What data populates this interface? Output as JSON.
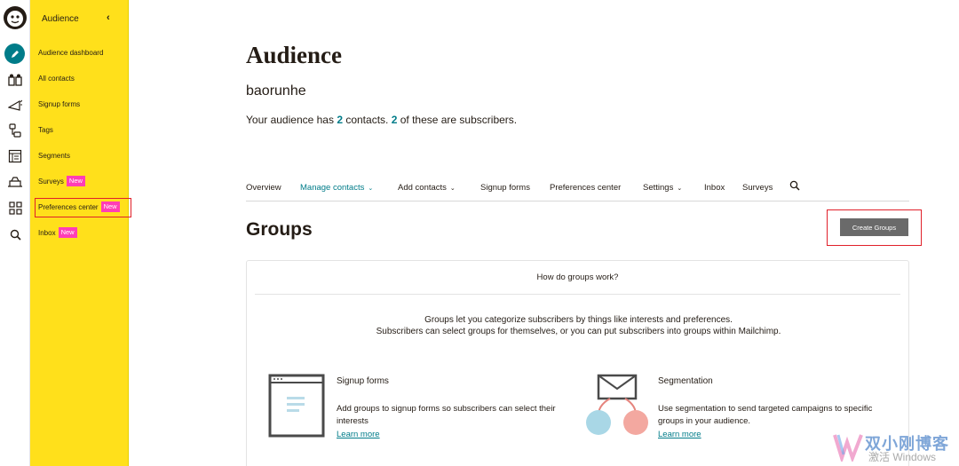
{
  "rail": {
    "icons": [
      "mailchimp-logo",
      "create-icon",
      "audience-icon",
      "campaigns-icon",
      "automations-icon",
      "website-icon",
      "content-icon",
      "integrations-icon",
      "search-icon"
    ]
  },
  "sidebar": {
    "title": "Audience",
    "collapse_icon": "‹",
    "items": [
      {
        "label": "Audience dashboard"
      },
      {
        "label": "All contacts"
      },
      {
        "label": "Signup forms"
      },
      {
        "label": "Tags"
      },
      {
        "label": "Segments"
      },
      {
        "label": "Surveys",
        "badge": "New"
      },
      {
        "label": "Preferences center",
        "badge": "New"
      },
      {
        "label": "Inbox",
        "badge": "New"
      }
    ]
  },
  "page": {
    "title": "Audience",
    "audience_name": "baorunhe",
    "summary": {
      "pre": "Your audience has ",
      "contacts": "2",
      "mid": " contacts. ",
      "subscribers": "2",
      "post": " of these are subscribers."
    }
  },
  "tabs": [
    {
      "label": "Overview",
      "caret": ""
    },
    {
      "label": "Manage contacts",
      "caret": "⌄"
    },
    {
      "label": "Add contacts",
      "caret": "⌄"
    },
    {
      "label": "Signup forms",
      "caret": ""
    },
    {
      "label": "Preferences center",
      "caret": ""
    },
    {
      "label": "Settings",
      "caret": "⌄"
    },
    {
      "label": "Inbox",
      "caret": ""
    },
    {
      "label": "Surveys",
      "caret": ""
    }
  ],
  "groups": {
    "title": "Groups",
    "create_button": "Create Groups",
    "card_header": "How do groups work?",
    "desc_line1": "Groups let you categorize subscribers by things like interests and preferences.",
    "desc_line2": "Subscribers can select groups for themselves, or you can put subscribers into groups within Mailchimp.",
    "features": [
      {
        "title": "Signup forms",
        "text": "Add groups to signup forms so subscribers can select their interests",
        "link": "Learn more"
      },
      {
        "title": "Segmentation",
        "text": "Use segmentation to send targeted campaigns to specific groups in your audience.",
        "link": "Learn more"
      }
    ]
  },
  "watermark": {
    "text": "双小刚博客",
    "sub": "激活 Windows"
  },
  "colors": {
    "sidebar": "#ffe01b",
    "accent": "#007c89",
    "badge": "#ff3eb5",
    "highlight": "#e0202a",
    "button": "#6a6a6a"
  }
}
